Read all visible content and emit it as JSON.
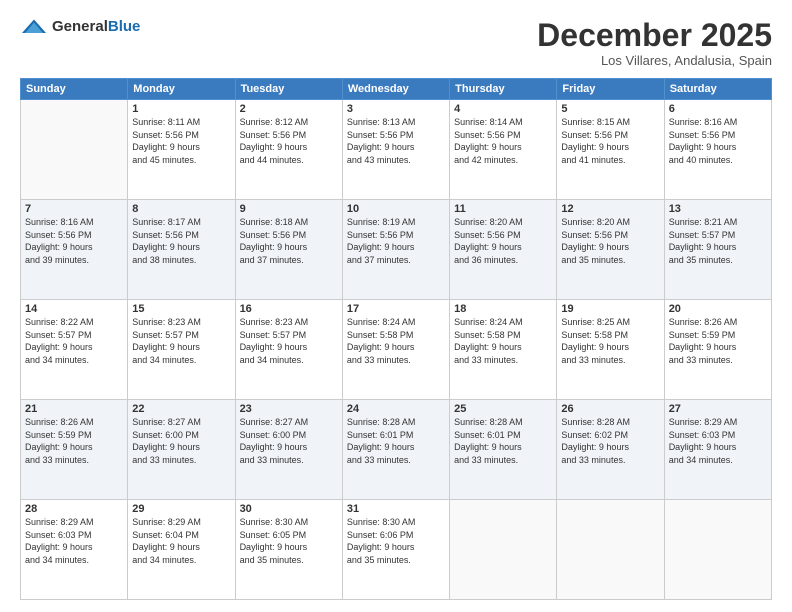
{
  "header": {
    "logo_general": "General",
    "logo_blue": "Blue",
    "month_title": "December 2025",
    "location": "Los Villares, Andalusia, Spain"
  },
  "weekdays": [
    "Sunday",
    "Monday",
    "Tuesday",
    "Wednesday",
    "Thursday",
    "Friday",
    "Saturday"
  ],
  "weeks": [
    [
      {
        "day": "",
        "info": ""
      },
      {
        "day": "1",
        "info": "Sunrise: 8:11 AM\nSunset: 5:56 PM\nDaylight: 9 hours\nand 45 minutes."
      },
      {
        "day": "2",
        "info": "Sunrise: 8:12 AM\nSunset: 5:56 PM\nDaylight: 9 hours\nand 44 minutes."
      },
      {
        "day": "3",
        "info": "Sunrise: 8:13 AM\nSunset: 5:56 PM\nDaylight: 9 hours\nand 43 minutes."
      },
      {
        "day": "4",
        "info": "Sunrise: 8:14 AM\nSunset: 5:56 PM\nDaylight: 9 hours\nand 42 minutes."
      },
      {
        "day": "5",
        "info": "Sunrise: 8:15 AM\nSunset: 5:56 PM\nDaylight: 9 hours\nand 41 minutes."
      },
      {
        "day": "6",
        "info": "Sunrise: 8:16 AM\nSunset: 5:56 PM\nDaylight: 9 hours\nand 40 minutes."
      }
    ],
    [
      {
        "day": "7",
        "info": "Sunrise: 8:16 AM\nSunset: 5:56 PM\nDaylight: 9 hours\nand 39 minutes."
      },
      {
        "day": "8",
        "info": "Sunrise: 8:17 AM\nSunset: 5:56 PM\nDaylight: 9 hours\nand 38 minutes."
      },
      {
        "day": "9",
        "info": "Sunrise: 8:18 AM\nSunset: 5:56 PM\nDaylight: 9 hours\nand 37 minutes."
      },
      {
        "day": "10",
        "info": "Sunrise: 8:19 AM\nSunset: 5:56 PM\nDaylight: 9 hours\nand 37 minutes."
      },
      {
        "day": "11",
        "info": "Sunrise: 8:20 AM\nSunset: 5:56 PM\nDaylight: 9 hours\nand 36 minutes."
      },
      {
        "day": "12",
        "info": "Sunrise: 8:20 AM\nSunset: 5:56 PM\nDaylight: 9 hours\nand 35 minutes."
      },
      {
        "day": "13",
        "info": "Sunrise: 8:21 AM\nSunset: 5:57 PM\nDaylight: 9 hours\nand 35 minutes."
      }
    ],
    [
      {
        "day": "14",
        "info": "Sunrise: 8:22 AM\nSunset: 5:57 PM\nDaylight: 9 hours\nand 34 minutes."
      },
      {
        "day": "15",
        "info": "Sunrise: 8:23 AM\nSunset: 5:57 PM\nDaylight: 9 hours\nand 34 minutes."
      },
      {
        "day": "16",
        "info": "Sunrise: 8:23 AM\nSunset: 5:57 PM\nDaylight: 9 hours\nand 34 minutes."
      },
      {
        "day": "17",
        "info": "Sunrise: 8:24 AM\nSunset: 5:58 PM\nDaylight: 9 hours\nand 33 minutes."
      },
      {
        "day": "18",
        "info": "Sunrise: 8:24 AM\nSunset: 5:58 PM\nDaylight: 9 hours\nand 33 minutes."
      },
      {
        "day": "19",
        "info": "Sunrise: 8:25 AM\nSunset: 5:58 PM\nDaylight: 9 hours\nand 33 minutes."
      },
      {
        "day": "20",
        "info": "Sunrise: 8:26 AM\nSunset: 5:59 PM\nDaylight: 9 hours\nand 33 minutes."
      }
    ],
    [
      {
        "day": "21",
        "info": "Sunrise: 8:26 AM\nSunset: 5:59 PM\nDaylight: 9 hours\nand 33 minutes."
      },
      {
        "day": "22",
        "info": "Sunrise: 8:27 AM\nSunset: 6:00 PM\nDaylight: 9 hours\nand 33 minutes."
      },
      {
        "day": "23",
        "info": "Sunrise: 8:27 AM\nSunset: 6:00 PM\nDaylight: 9 hours\nand 33 minutes."
      },
      {
        "day": "24",
        "info": "Sunrise: 8:28 AM\nSunset: 6:01 PM\nDaylight: 9 hours\nand 33 minutes."
      },
      {
        "day": "25",
        "info": "Sunrise: 8:28 AM\nSunset: 6:01 PM\nDaylight: 9 hours\nand 33 minutes."
      },
      {
        "day": "26",
        "info": "Sunrise: 8:28 AM\nSunset: 6:02 PM\nDaylight: 9 hours\nand 33 minutes."
      },
      {
        "day": "27",
        "info": "Sunrise: 8:29 AM\nSunset: 6:03 PM\nDaylight: 9 hours\nand 34 minutes."
      }
    ],
    [
      {
        "day": "28",
        "info": "Sunrise: 8:29 AM\nSunset: 6:03 PM\nDaylight: 9 hours\nand 34 minutes."
      },
      {
        "day": "29",
        "info": "Sunrise: 8:29 AM\nSunset: 6:04 PM\nDaylight: 9 hours\nand 34 minutes."
      },
      {
        "day": "30",
        "info": "Sunrise: 8:30 AM\nSunset: 6:05 PM\nDaylight: 9 hours\nand 35 minutes."
      },
      {
        "day": "31",
        "info": "Sunrise: 8:30 AM\nSunset: 6:06 PM\nDaylight: 9 hours\nand 35 minutes."
      },
      {
        "day": "",
        "info": ""
      },
      {
        "day": "",
        "info": ""
      },
      {
        "day": "",
        "info": ""
      }
    ]
  ],
  "shaded_rows": [
    1,
    3
  ]
}
